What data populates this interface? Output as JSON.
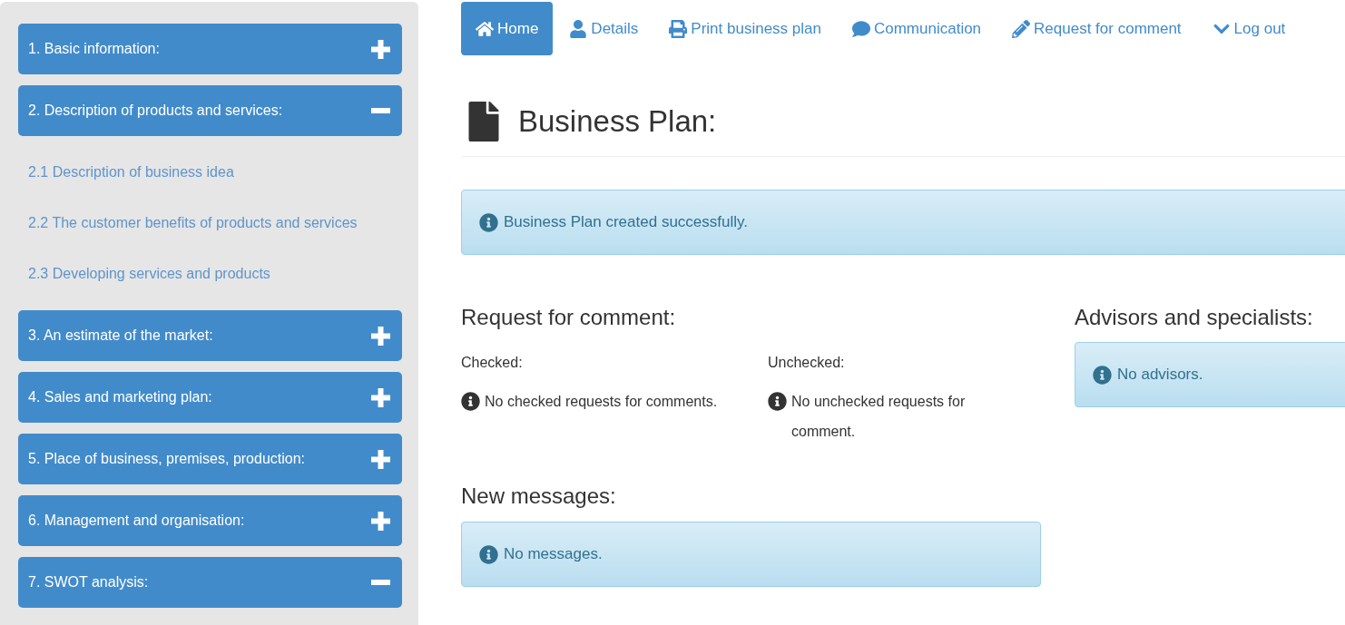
{
  "sidebar": {
    "sections": [
      {
        "label": "1. Basic information:",
        "expanded": false
      },
      {
        "label": "2. Description of products and services:",
        "expanded": true,
        "children": [
          {
            "label": "2.1 Description of business idea"
          },
          {
            "label": "2.2 The customer benefits of products and services"
          },
          {
            "label": "2.3 Developing services and products"
          }
        ]
      },
      {
        "label": "3. An estimate of the market:",
        "expanded": false
      },
      {
        "label": "4. Sales and marketing plan:",
        "expanded": false
      },
      {
        "label": "5. Place of business, premises, production:",
        "expanded": false
      },
      {
        "label": "6. Management and organisation:",
        "expanded": false
      },
      {
        "label": "7. SWOT analysis:",
        "expanded": true
      }
    ]
  },
  "nav": {
    "items": [
      {
        "label": "Home",
        "selected": true
      },
      {
        "label": "Details",
        "selected": false
      },
      {
        "label": "Print business plan",
        "selected": false
      },
      {
        "label": "Communication",
        "selected": false
      },
      {
        "label": "Request for comment",
        "selected": false
      },
      {
        "label": "Log out",
        "selected": false
      }
    ]
  },
  "page_title": "Business Plan:",
  "status_alert": {
    "text": "Business Plan created successfully."
  },
  "request_for_comment": {
    "heading": "Request for comment:",
    "columns": [
      {
        "label": "Checked:",
        "message": "No checked requests for comments."
      },
      {
        "label": "Unchecked:",
        "message": "No unchecked requests for comment."
      }
    ]
  },
  "new_messages": {
    "heading": "New messages:",
    "alert": {
      "text": "No messages."
    }
  },
  "advisors": {
    "heading": "Advisors and specialists:",
    "alert": {
      "text": "No advisors."
    }
  }
}
